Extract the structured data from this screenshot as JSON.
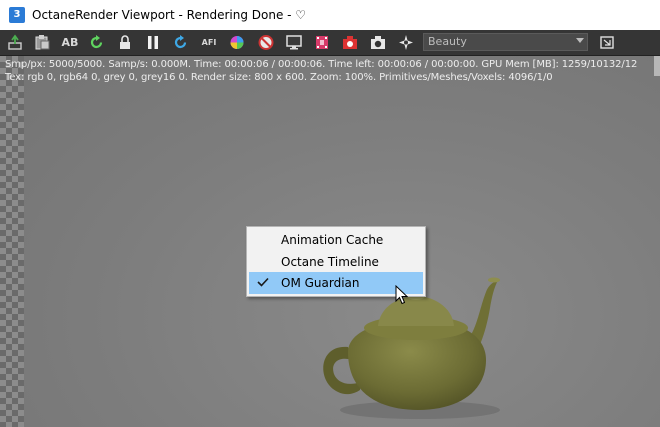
{
  "window": {
    "title": "OctaneRender Viewport - Rendering Done - ♡",
    "icon_label": "3"
  },
  "toolbar": {
    "icons": [
      "export-icon",
      "clipboard-icon",
      "ab-compare-icon",
      "restart-render-icon",
      "lock-icon",
      "pause-icon",
      "refresh-icon",
      "aperture-icon",
      "color-wheel-icon",
      "cancel-icon",
      "monitor-icon",
      "film-icon",
      "camera-red-icon",
      "camera-icon",
      "settings-star-icon",
      "region-icon"
    ],
    "ab_label": "AB",
    "afl_label": "AFI",
    "pass_select": {
      "value": "Beauty"
    }
  },
  "stats": {
    "line1": "Smp/px: 5000/5000.   Samp/s: 0.000M.   Time: 00:00:06 / 00:00:06.   Time left: 00:00:06 / 00:00:00.   GPU Mem [MB]: 1259/10132/12",
    "line2": "Tex: rgb 0, rgb64 0, grey 0, grey16 0.   Render size: 800 x 600.   Zoom: 100%.   Primitives/Meshes/Voxels: 4096/1/0"
  },
  "context_menu": {
    "items": [
      {
        "label": "Animation Cache",
        "checked": false
      },
      {
        "label": "Octane Timeline",
        "checked": false
      },
      {
        "label": "OM Guardian",
        "checked": true,
        "highlighted": true
      }
    ]
  },
  "colors": {
    "toolbar_bg": "#353535",
    "viewport_bg": "#7c7c7c",
    "menu_highlight": "#91c9f7",
    "teapot": "#707038"
  }
}
